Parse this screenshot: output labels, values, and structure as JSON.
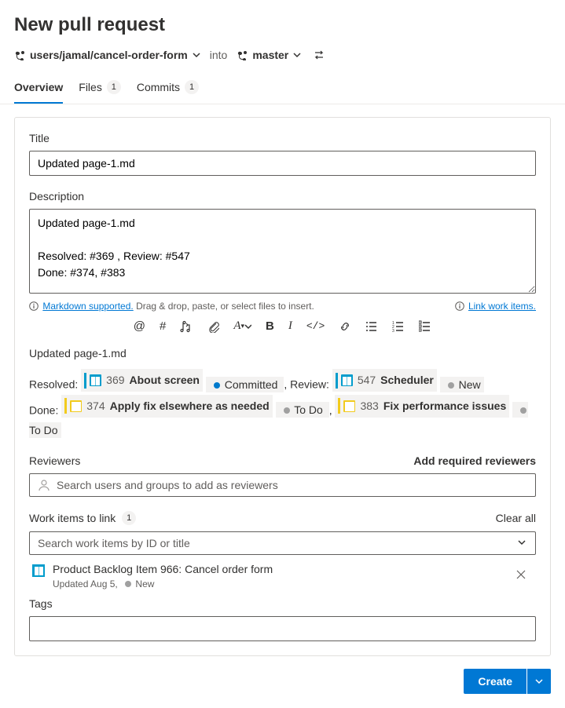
{
  "header": {
    "title": "New pull request",
    "source_branch": "users/jamal/cancel-order-form",
    "into": "into",
    "target_branch": "master"
  },
  "tabs": {
    "overview": "Overview",
    "files": "Files",
    "files_count": "1",
    "commits": "Commits",
    "commits_count": "1"
  },
  "form": {
    "title_label": "Title",
    "title_value": "Updated page-1.md",
    "description_label": "Description",
    "description_value": "Updated page-1.md\n\nResolved: #369 , Review: #547\nDone: #374, #383",
    "markdown_text": "Markdown supported.",
    "drag_text": " Drag & drop, paste, or select files to insert.",
    "link_work_items": "Link work items."
  },
  "preview": {
    "title": "Updated page-1.md",
    "lines": {
      "resolved_label": "Resolved:",
      "resolved_item": {
        "id": "369",
        "title": "About screen",
        "state": "Committed",
        "color": "#009ccc",
        "bar": "#009ccc",
        "dot": "#007acc"
      },
      "review_label": ", Review:",
      "review_item": {
        "id": "547",
        "title": "Scheduler",
        "state": "New",
        "color": "#009ccc",
        "bar": "#009ccc",
        "dot": "#a0a0a0"
      },
      "done_label": "Done:",
      "done_items": [
        {
          "id": "374",
          "title": "Apply fix elsewhere as needed",
          "state": "To Do",
          "color": "#f2cb1d",
          "bar": "#f2cb1d",
          "dot": "#a0a0a0"
        },
        {
          "id": "383",
          "title": "Fix performance issues",
          "state": "To Do",
          "color": "#f2cb1d",
          "bar": "#f2cb1d",
          "dot": "#a0a0a0"
        }
      ]
    }
  },
  "reviewers": {
    "label": "Reviewers",
    "add_required": "Add required reviewers",
    "placeholder": "Search users and groups to add as reviewers"
  },
  "work_items": {
    "label": "Work items to link",
    "count": "1",
    "clear": "Clear all",
    "placeholder": "Search work items by ID or title",
    "linked": {
      "title": "Product Backlog Item 966: Cancel order form",
      "updated": "Updated Aug 5,",
      "state": "New"
    }
  },
  "tags": {
    "label": "Tags"
  },
  "footer": {
    "create": "Create"
  }
}
